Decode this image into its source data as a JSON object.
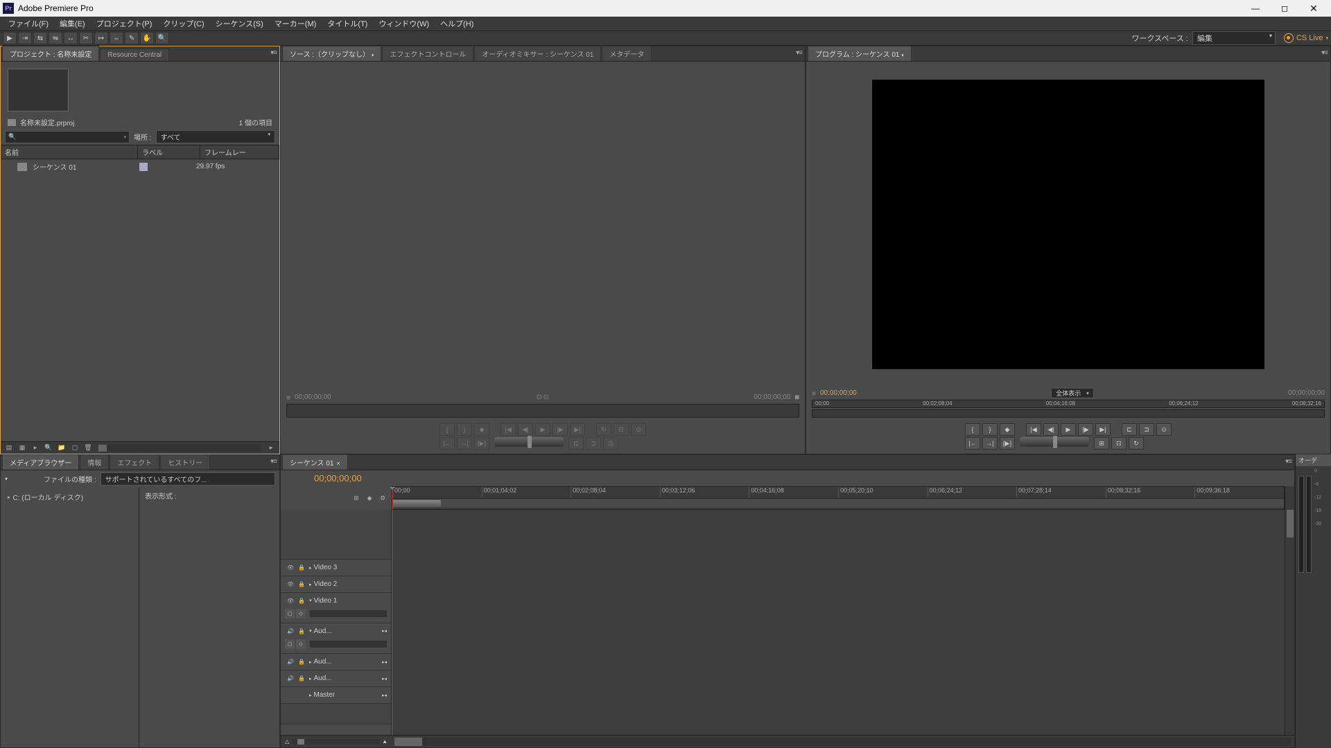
{
  "title": "Adobe Premiere Pro",
  "menus": [
    "ファイル(F)",
    "編集(E)",
    "プロジェクト(P)",
    "クリップ(C)",
    "シーケンス(S)",
    "マーカー(M)",
    "タイトル(T)",
    "ウィンドウ(W)",
    "ヘルプ(H)"
  ],
  "workspace": {
    "label": "ワークスペース :",
    "value": "編集"
  },
  "cslive": "CS Live",
  "project": {
    "tab": "プロジェクト : 名称未設定",
    "tab2": "Resource Central",
    "filename": "名称未設定.prproj",
    "count": "1 個の項目",
    "loc_label": "場所 :",
    "loc_value": "すべて",
    "cols": {
      "name": "名前",
      "label": "ラベル",
      "rate": "フレームレー"
    },
    "item": {
      "name": "シーケンス 01",
      "rate": "29.97 fps"
    }
  },
  "source": {
    "tab": "ソース :（クリップなし）",
    "tabs": [
      "エフェクトコントロール",
      "オーディオミキサー : シーケンス 01",
      "メタデータ"
    ],
    "tc_in": "00;00;00;00",
    "tc_out": "00;00;00;00"
  },
  "program": {
    "tab": "プログラム : シーケンス 01",
    "tc_cur": "00;00;00;00",
    "tc_dur": "00;00;00;00",
    "zoom": "全体表示",
    "ruler": [
      "00;00",
      "00;02;08;04",
      "00;04;16;08",
      "00;06;24;12",
      "00;08;32;16"
    ]
  },
  "mbrowser": {
    "tab": "メディアブラウザー",
    "tabs": [
      "情報",
      "エフェクト",
      "ヒストリー"
    ],
    "filter_label": "ファイルの種類 :",
    "filter_value": "サポートされているすべてのフ...",
    "drive": "C: (ローカル ディスク)",
    "disp_label": "表示形式 :"
  },
  "timeline": {
    "tab": "シーケンス 01",
    "tc": "00;00;00;00",
    "ruler": [
      "00;00",
      "00;01;04;02",
      "00;02;08;04",
      "00;03;12;06",
      "00;04;16;08",
      "00;05;20;10",
      "00;06;24;12",
      "00;07;28;14",
      "00;08;32;16",
      "00;09;36;18"
    ],
    "tracks": {
      "v3": "Video 3",
      "v2": "Video 2",
      "v1": "Video 1",
      "a1": "Aud...",
      "a2": "Aud...",
      "a3": "Aud...",
      "master": "Master"
    }
  },
  "meters": {
    "tab": "オーデ",
    "marks": [
      "0",
      "-6",
      "-12",
      "-18",
      "-30"
    ]
  }
}
